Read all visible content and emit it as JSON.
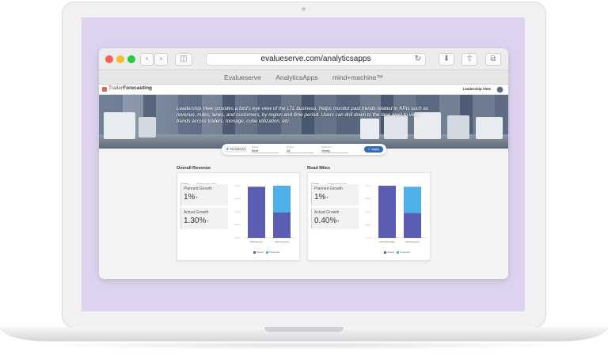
{
  "browser": {
    "url": "evalueserve.com/analyticsapps",
    "bookmarks": [
      "Evalueserve",
      "AnalyticsApps",
      "mind+machine™"
    ]
  },
  "app": {
    "logo_prefix": "Trailer",
    "logo_suffix": "Forecasting",
    "view_label": "Leadership View",
    "banner_text": "Leadership View provides a bird's eye view of the LTL business. Helps monitor past trends related to KPIs such as revenue, miles, lanes, and customers, by region and time period. Users can drill down to the lane level to view trends across trailers, tonnage, cube utilization, etc.",
    "filter": {
      "button_label": "FILTER BY",
      "groups": [
        {
          "label": "Metric",
          "value": "Beef"
        },
        {
          "label": "Region",
          "value": "All"
        },
        {
          "label": "Date/Time",
          "value": "Yearly"
        }
      ],
      "apply_label": "Apply"
    },
    "colors": {
      "actual": "#5b5db3",
      "projected": "#4db0e8",
      "positive": "#3aa655",
      "accent": "#2e6db8"
    },
    "panels": [
      {
        "title": "Overall Revenue",
        "tabs": [
          "Charts",
          "Underlying Data"
        ],
        "planned_label": "Planned Growth",
        "planned_value": "1%",
        "actual_label": "Actual Growth",
        "actual_value": "1.30%",
        "plus": "+",
        "legend": [
          "Actual",
          "Projected"
        ]
      },
      {
        "title": "Road Miles",
        "tabs": [
          "Charts",
          "Underlying Data"
        ],
        "planned_label": "Planned Growth",
        "planned_value": "1%",
        "actual_label": "Actual Growth",
        "actual_value": "0.40%",
        "plus": "+",
        "legend": [
          "Actual",
          "Projected"
        ]
      }
    ]
  },
  "chart_data": [
    {
      "type": "bar",
      "categories": [
        "2019 Revenue",
        "2019 Projected"
      ],
      "series": [
        {
          "name": "Actual",
          "values": [
            100,
            50
          ]
        },
        {
          "name": "Projected",
          "values": [
            0,
            52
          ]
        }
      ],
      "stacked": true
    },
    {
      "type": "bar",
      "categories": [
        "2019 Road Miles",
        "2019 Projected"
      ],
      "series": [
        {
          "name": "Actual",
          "values": [
            100,
            48
          ]
        },
        {
          "name": "Projected",
          "values": [
            0,
            50
          ]
        }
      ],
      "stacked": true
    }
  ]
}
